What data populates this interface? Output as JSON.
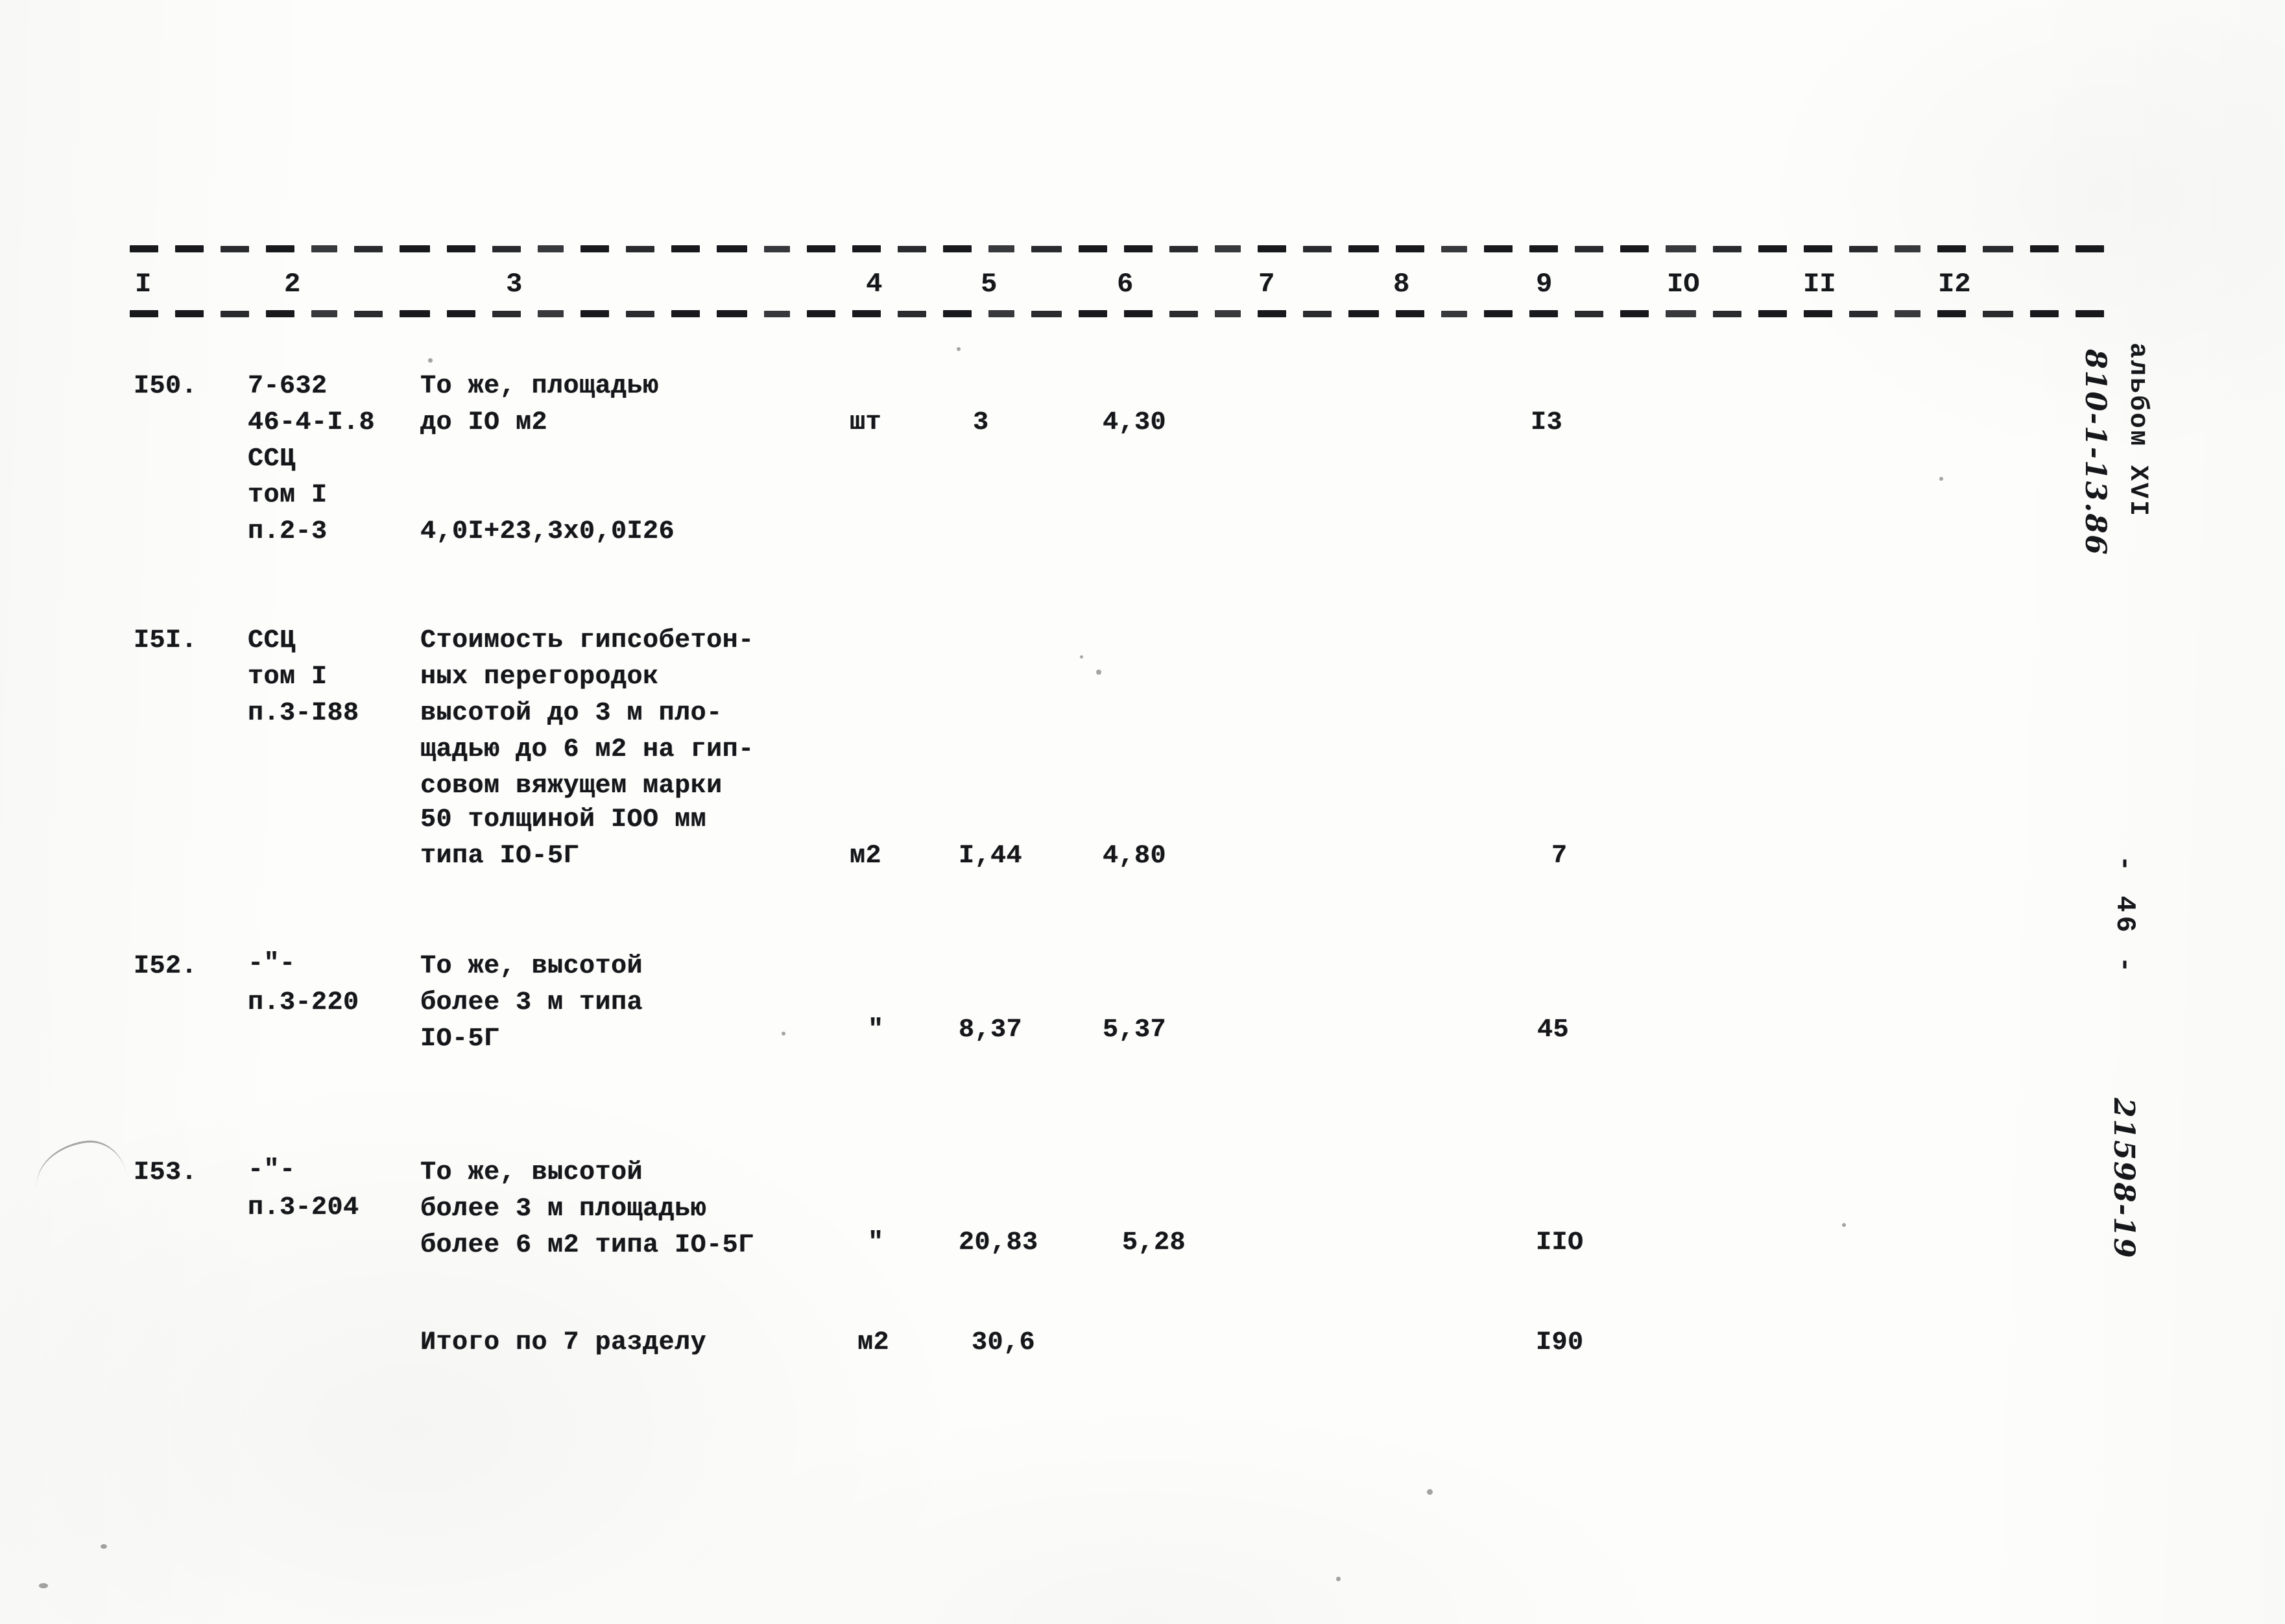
{
  "document": {
    "type": "scanned-estimate-table",
    "header_columns": [
      "I",
      "2",
      "3",
      "4",
      "5",
      "6",
      "7",
      "8",
      "9",
      "IO",
      "II",
      "I2"
    ]
  },
  "margins": {
    "album_label": "альбом XVI",
    "album_code": "810-1-13.86",
    "page_marker": "- 46 -",
    "archive_code": "21598-19"
  },
  "rows": [
    {
      "num": "I50.",
      "code_lines": [
        "7-632",
        "46-4-I.8",
        "ССЦ",
        "том I",
        "п.2-3"
      ],
      "desc_lines": [
        "То же, площадью",
        "до IO м2",
        "",
        "",
        "4,0I+23,3х0,0I26"
      ],
      "unit": "шт",
      "qty": "3",
      "price": "4,30",
      "total": "I3"
    },
    {
      "num": "I5I.",
      "code_lines": [
        "ССЦ",
        "том I",
        "п.3-I88"
      ],
      "desc_lines": [
        "Стоимость гипсобетон-",
        "ных перегородок",
        "высотой до 3 м пло-",
        "щадью до 6 м2 на гип-",
        "совом вяжущем марки",
        "50 толщиной IОО мм",
        "типа IО-5Г"
      ],
      "unit": "м2",
      "qty": "I,44",
      "price": "4,80",
      "total": "7"
    },
    {
      "num": "I52.",
      "code_lines": [
        "-\"-",
        "п.3-220"
      ],
      "desc_lines": [
        "То же, высотой",
        "более 3 м типа",
        "IО-5Г"
      ],
      "unit": "\"",
      "qty": "8,37",
      "price": "5,37",
      "total": "45"
    },
    {
      "num": "I53.",
      "code_lines": [
        "-\"-",
        "п.3-204"
      ],
      "desc_lines": [
        "То же, высотой",
        "более 3 м площадью",
        "более 6 м2 типа IО-5Г"
      ],
      "unit": "\"",
      "qty": "20,83",
      "price": "5,28",
      "total": "IIO"
    }
  ],
  "summary": {
    "label": "Итого по 7 разделу",
    "unit": "м2",
    "qty": "30,6",
    "total": "I90"
  }
}
